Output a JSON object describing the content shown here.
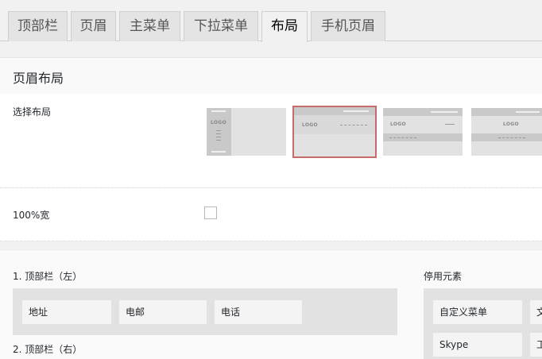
{
  "tabs": [
    {
      "label": "顶部栏"
    },
    {
      "label": "页眉"
    },
    {
      "label": "主菜单"
    },
    {
      "label": "下拉菜单"
    },
    {
      "label": "布局"
    },
    {
      "label": "手机页眉"
    }
  ],
  "active_tab": "布局",
  "section": {
    "title": "页眉布局"
  },
  "layout_row": {
    "label": "选择布局",
    "logo_text": "LOGO",
    "selected_index": 1
  },
  "width_row": {
    "label": "100%宽",
    "checked": false
  },
  "builder": {
    "left_group": {
      "title": "1. 顶部栏（左）",
      "items": [
        "地址",
        "电邮",
        "电话"
      ]
    },
    "right_group": {
      "title": "2. 顶部栏（右）"
    },
    "disabled": {
      "title": "停用元素",
      "items": [
        "自定义菜单",
        "文",
        "Skype",
        "工"
      ]
    }
  },
  "colors": {
    "selected_outline": "#c76b6b",
    "zone": "#e2e2e2",
    "chip": "#f4f4f4"
  }
}
